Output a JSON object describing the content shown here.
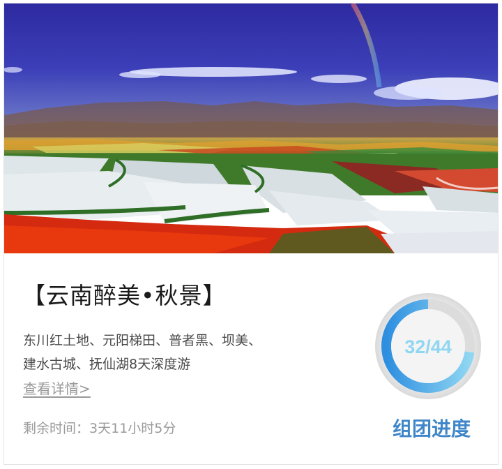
{
  "tour": {
    "title": "【云南醉美•秋景】",
    "description_lines": [
      "东川红土地、元阳梯田、普者黑、坝美、",
      "建水古城、抚仙湖8天深度游"
    ],
    "details_link": "查看详情>",
    "remaining_label": "剩余时间：",
    "remaining_value": "3天11小时5分"
  },
  "group_progress": {
    "label": "组团进度",
    "text": "32/44",
    "current": 32,
    "total": 44,
    "fraction": 0.727
  },
  "colors": {
    "accent_blue": "#3f86c9",
    "ring_blue": "#2e8fe0",
    "ring_light": "#8fd6f2",
    "muted_gray": "#9a9a9a"
  },
  "image": {
    "alt": "云南红土地梯田风景"
  }
}
